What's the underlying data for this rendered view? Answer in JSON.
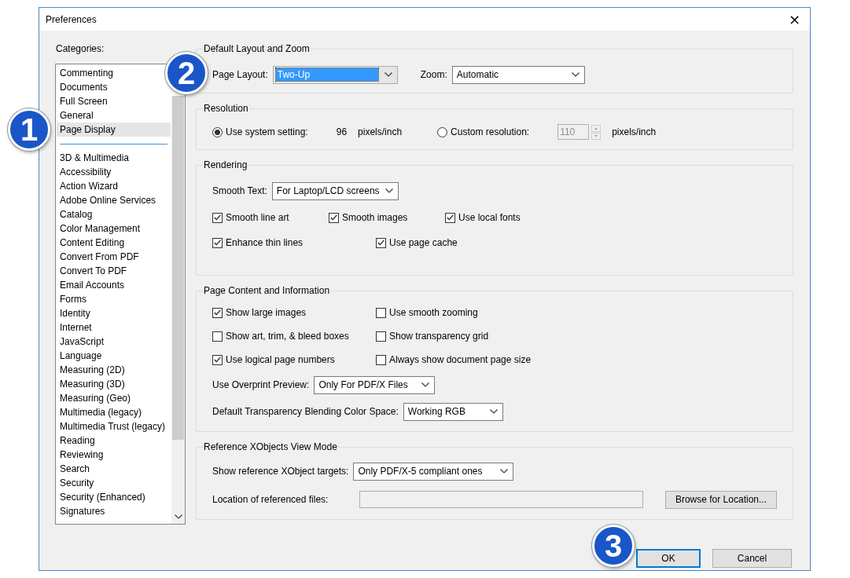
{
  "window": {
    "title": "Preferences",
    "close": "×"
  },
  "categories": {
    "label": "Categories:",
    "groups": [
      {
        "items": [
          {
            "label": "Commenting",
            "selected": false
          },
          {
            "label": "Documents",
            "selected": false
          },
          {
            "label": "Full Screen",
            "selected": false
          },
          {
            "label": "General",
            "selected": false
          },
          {
            "label": "Page Display",
            "selected": true
          }
        ]
      },
      {
        "items": [
          {
            "label": "3D & Multimedia",
            "selected": false
          },
          {
            "label": "Accessibility",
            "selected": false
          },
          {
            "label": "Action Wizard",
            "selected": false
          },
          {
            "label": "Adobe Online Services",
            "selected": false
          },
          {
            "label": "Catalog",
            "selected": false
          },
          {
            "label": "Color Management",
            "selected": false
          },
          {
            "label": "Content Editing",
            "selected": false
          },
          {
            "label": "Convert From PDF",
            "selected": false
          },
          {
            "label": "Convert To PDF",
            "selected": false
          },
          {
            "label": "Email Accounts",
            "selected": false
          },
          {
            "label": "Forms",
            "selected": false
          },
          {
            "label": "Identity",
            "selected": false
          },
          {
            "label": "Internet",
            "selected": false
          },
          {
            "label": "JavaScript",
            "selected": false
          },
          {
            "label": "Language",
            "selected": false
          },
          {
            "label": "Measuring (2D)",
            "selected": false
          },
          {
            "label": "Measuring (3D)",
            "selected": false
          },
          {
            "label": "Measuring (Geo)",
            "selected": false
          },
          {
            "label": "Multimedia (legacy)",
            "selected": false
          },
          {
            "label": "Multimedia Trust (legacy)",
            "selected": false
          },
          {
            "label": "Reading",
            "selected": false
          },
          {
            "label": "Reviewing",
            "selected": false
          },
          {
            "label": "Search",
            "selected": false
          },
          {
            "label": "Security",
            "selected": false
          },
          {
            "label": "Security (Enhanced)",
            "selected": false
          },
          {
            "label": "Signatures",
            "selected": false
          }
        ]
      }
    ]
  },
  "sections": [
    {
      "title": "Default Layout and Zoom",
      "rows": [
        {
          "items": [
            {
              "kind": "dropdown",
              "label": "Page Layout:",
              "value": "Two-Up",
              "focused": true
            },
            {
              "kind": "dropdown",
              "label": "Zoom:",
              "value": "Automatic",
              "focused": false
            }
          ]
        }
      ]
    },
    {
      "title": "Resolution",
      "rows": [
        {
          "items": [
            {
              "kind": "radio",
              "label": "Use system setting:",
              "selected": true
            },
            {
              "kind": "text",
              "text": "96"
            },
            {
              "kind": "text",
              "text": "pixels/inch"
            },
            {
              "kind": "radio",
              "label": "Custom resolution:",
              "selected": false
            },
            {
              "kind": "spin",
              "value": "110",
              "disabled": true
            },
            {
              "kind": "text",
              "text": "pixels/inch"
            }
          ]
        }
      ]
    },
    {
      "title": "Rendering",
      "rows": [
        {
          "items": [
            {
              "kind": "dropdown",
              "label": "Smooth Text:",
              "value": "For Laptop/LCD screens",
              "focused": false
            }
          ]
        },
        {
          "items": [
            {
              "kind": "checkbox",
              "label": "Smooth line art",
              "checked": true
            },
            {
              "kind": "checkbox",
              "label": "Smooth images",
              "checked": true
            },
            {
              "kind": "checkbox",
              "label": "Use local fonts",
              "checked": true
            }
          ]
        },
        {
          "items": [
            {
              "kind": "checkbox",
              "label": "Enhance thin lines",
              "checked": true
            },
            {
              "kind": "checkbox",
              "label": "Use page cache",
              "checked": true
            }
          ]
        }
      ]
    },
    {
      "title": "Page Content and Information",
      "rows": [
        {
          "items": [
            {
              "kind": "checkbox",
              "label": "Show large images",
              "checked": true
            },
            {
              "kind": "checkbox",
              "label": "Use smooth zooming",
              "checked": false
            }
          ]
        },
        {
          "items": [
            {
              "kind": "checkbox",
              "label": "Show art, trim, & bleed boxes",
              "checked": false
            },
            {
              "kind": "checkbox",
              "label": "Show transparency grid",
              "checked": false
            }
          ]
        },
        {
          "items": [
            {
              "kind": "checkbox",
              "label": "Use logical page numbers",
              "checked": true
            },
            {
              "kind": "checkbox",
              "label": "Always show document page size",
              "checked": false
            }
          ]
        },
        {
          "items": [
            {
              "kind": "dropdown",
              "label": "Use Overprint Preview:",
              "value": "Only For PDF/X Files",
              "focused": false
            }
          ]
        },
        {
          "items": [
            {
              "kind": "dropdown",
              "label": "Default Transparency Blending Color Space:",
              "value": "Working RGB",
              "focused": false
            }
          ]
        }
      ]
    },
    {
      "title": "Reference XObjects View Mode",
      "rows": [
        {
          "items": [
            {
              "kind": "dropdown",
              "label": "Show reference XObject targets:",
              "value": "Only PDF/X-5 compliant ones",
              "focused": false
            }
          ]
        },
        {
          "items": [
            {
              "kind": "field",
              "label": "Location of referenced files:"
            },
            {
              "kind": "button",
              "label": "Browse for Location..."
            }
          ]
        }
      ]
    }
  ],
  "buttons": [
    {
      "label": "OK",
      "focused": true
    },
    {
      "label": "Cancel",
      "focused": false
    }
  ],
  "callouts": [
    "1",
    "2",
    "3"
  ]
}
